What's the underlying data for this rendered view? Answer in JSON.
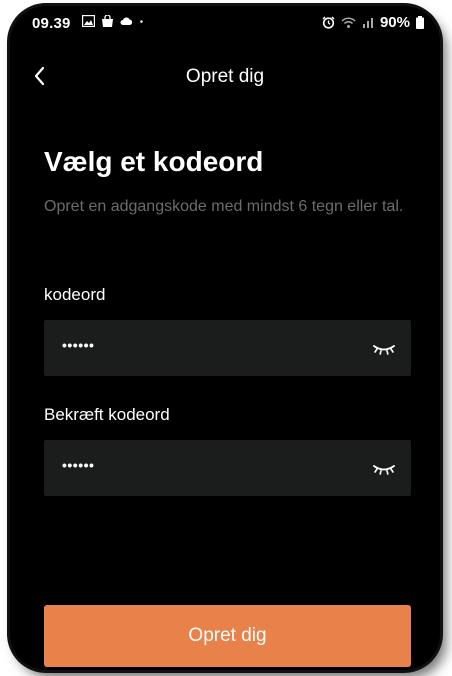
{
  "status_bar": {
    "time": "09.39",
    "battery": "90%",
    "left_icons": [
      "image-icon",
      "shopping-bag-icon",
      "cloud-icon",
      "dot-icon"
    ],
    "right_icons": [
      "alarm-icon",
      "wifi-icon",
      "signal-icon",
      "battery-icon"
    ]
  },
  "nav": {
    "back_icon": "chevron-left-icon",
    "title": "Opret dig"
  },
  "main": {
    "heading": "Vælg et kodeord",
    "subtitle": "Opret en adgangskode med mindst 6 tegn eller tal.",
    "fields": [
      {
        "label": "kodeord",
        "value": "••••••",
        "toggle_icon": "eye-closed-icon"
      },
      {
        "label": "Bekræft kodeord",
        "value": "••••••",
        "toggle_icon": "eye-closed-icon"
      }
    ],
    "submit_label": "Opret dig"
  },
  "colors": {
    "background": "#000000",
    "field_background": "#1b1c1c",
    "subtitle_text": "#6c6c6c",
    "accent": "#e9814a"
  }
}
